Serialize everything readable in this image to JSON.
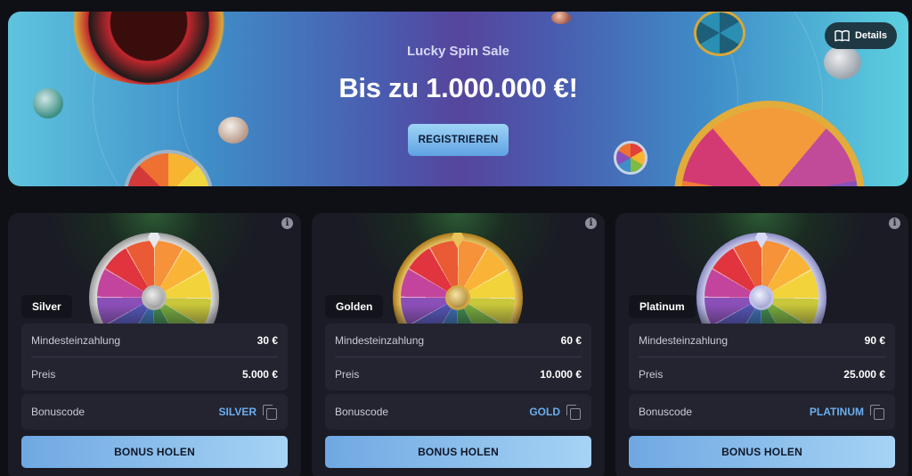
{
  "banner": {
    "title": "Lucky Spin Sale",
    "amount": "Bis zu 1.000.000 €!",
    "cta_label": "REGISTRIEREN",
    "details_label": "Details"
  },
  "cards": [
    {
      "tier": "Silver",
      "min_deposit_label": "Mindesteinzahlung",
      "min_deposit_value": "30 €",
      "price_label": "Preis",
      "price_value": "5.000 €",
      "code_label": "Bonuscode",
      "code_value": "SILVER",
      "button_label": "BONUS HOLEN",
      "rim_color": "#d9d9d9"
    },
    {
      "tier": "Golden",
      "min_deposit_label": "Mindesteinzahlung",
      "min_deposit_value": "60 €",
      "price_label": "Preis",
      "price_value": "10.000 €",
      "code_label": "Bonuscode",
      "code_value": "GOLD",
      "button_label": "BONUS HOLEN",
      "rim_color": "#e6c25a"
    },
    {
      "tier": "Platinum",
      "min_deposit_label": "Mindesteinzahlung",
      "min_deposit_value": "90 €",
      "price_label": "Preis",
      "price_value": "25.000 €",
      "code_label": "Bonuscode",
      "code_value": "PLATINUM",
      "button_label": "BONUS HOLEN",
      "rim_color": "#c7c9ef"
    }
  ],
  "colors": {
    "accent": "#6aaef0",
    "background": "#0f1016",
    "card": "#1a1b25"
  },
  "icons": {
    "details": "book-open-icon",
    "info": "info-icon",
    "copy": "copy-icon"
  }
}
